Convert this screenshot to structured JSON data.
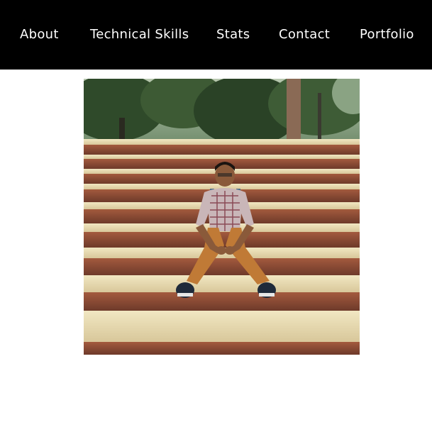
{
  "nav": {
    "items": [
      {
        "label": "About"
      },
      {
        "label": "Technical Skills"
      },
      {
        "label": "Stats"
      },
      {
        "label": "Contact"
      },
      {
        "label": "Portfolio"
      }
    ]
  },
  "colors": {
    "nav_background": "#000000",
    "nav_text": "#ffffff",
    "page_background": "#ffffff"
  },
  "profile_photo": {
    "subject": "person-sitting-on-stone-steps"
  }
}
